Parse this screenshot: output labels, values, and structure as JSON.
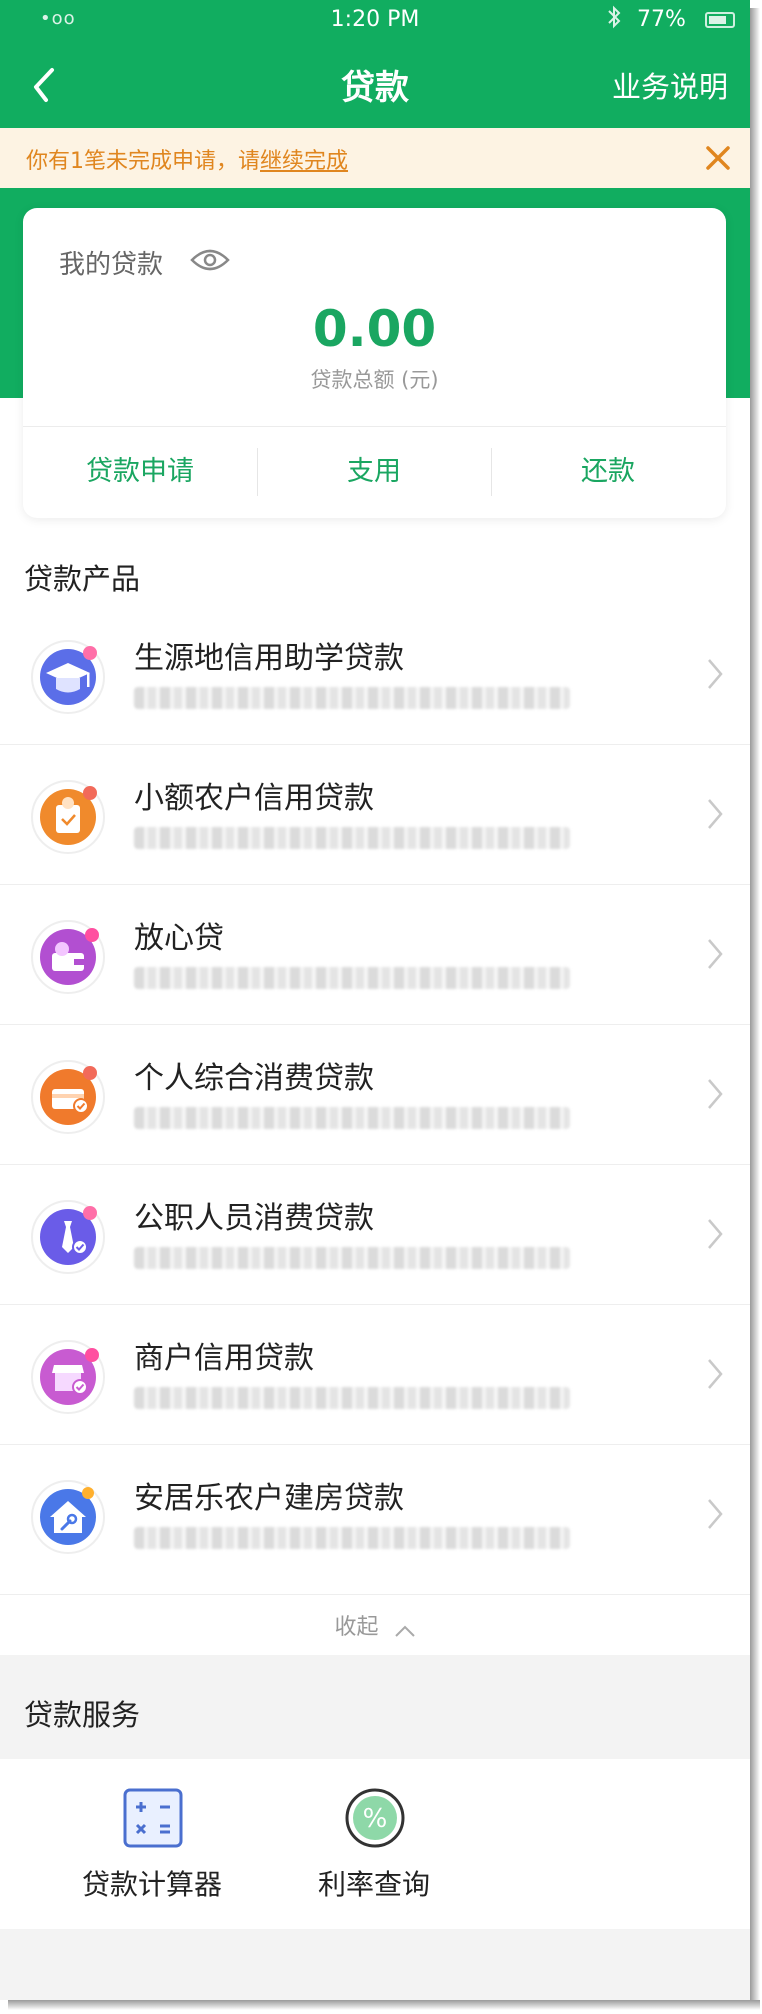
{
  "status_bar": {
    "signal": "•oo",
    "time": "1:20 PM",
    "battery": "77%"
  },
  "nav": {
    "title": "贷款",
    "help_label": "业务说明"
  },
  "notice": {
    "text_prefix": "你有1笔未完成申请，请",
    "link_text": "继续完成"
  },
  "loan_card": {
    "title": "我的贷款",
    "amount": "0.00",
    "amount_label": "贷款总额 (元)",
    "actions": [
      "贷款申请",
      "支用",
      "还款"
    ]
  },
  "products_section": {
    "title": "贷款产品",
    "items": [
      {
        "name": "生源地信用助学贷款",
        "icon": "graduation-cap-icon",
        "accent": "#5b6ee8"
      },
      {
        "name": "小额农户信用贷款",
        "icon": "clipboard-yen-icon",
        "accent": "#f08a2c"
      },
      {
        "name": "放心贷",
        "icon": "wallet-yen-icon",
        "accent": "#b24fd1"
      },
      {
        "name": "个人综合消费贷款",
        "icon": "card-check-icon",
        "accent": "#f07a2c"
      },
      {
        "name": "公职人员消费贷款",
        "icon": "tie-check-icon",
        "accent": "#6a5ce8"
      },
      {
        "name": "商户信用贷款",
        "icon": "shop-check-icon",
        "accent": "#c85bd1"
      },
      {
        "name": "安居乐农户建房贷款",
        "icon": "house-wrench-icon",
        "accent": "#4a78e8"
      }
    ],
    "collapse_label": "收起"
  },
  "services_section": {
    "title": "贷款服务",
    "items": [
      {
        "label": "贷款计算器",
        "icon": "calculator-icon"
      },
      {
        "label": "利率查询",
        "icon": "percent-icon"
      }
    ]
  },
  "colors": {
    "brand_green": "#11ad60",
    "notice_orange": "#e0861f"
  }
}
